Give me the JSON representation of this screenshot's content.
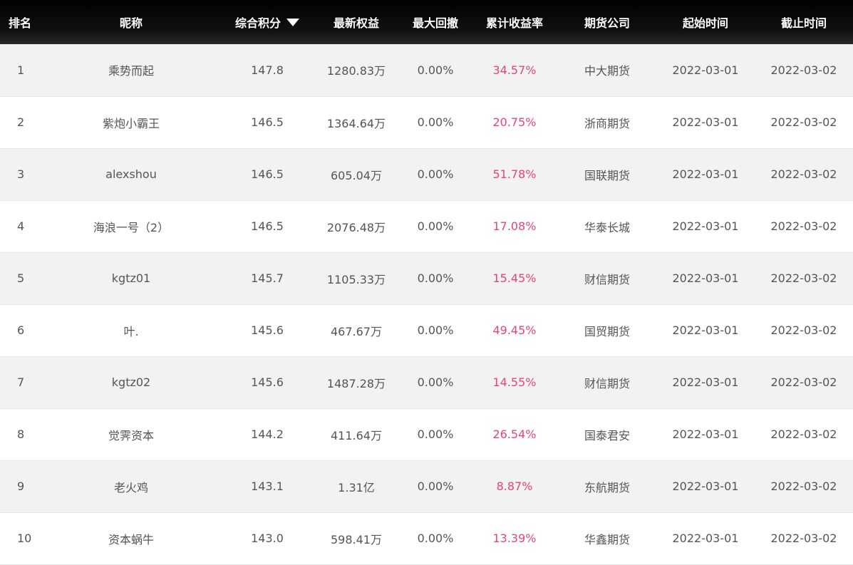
{
  "table": {
    "headers": {
      "rank": "排名",
      "nickname": "昵称",
      "score": "综合积分",
      "equity": "最新权益",
      "max_drawdown": "最大回撤",
      "cum_return": "累计收益率",
      "company": "期货公司",
      "start": "起始时间",
      "end": "截止时间"
    },
    "sort_icon": "triangle-down-icon",
    "colors": {
      "header_bg": "#000000",
      "return_text": "#e8437a",
      "row_alt": "#f2f2f2"
    },
    "rows": [
      {
        "rank": "1",
        "nickname": "乘势而起",
        "score": "147.8",
        "equity": "1280.83万",
        "max_drawdown": "0.00%",
        "cum_return": "34.57%",
        "company": "中大期货",
        "start": "2022-03-01",
        "end": "2022-03-02"
      },
      {
        "rank": "2",
        "nickname": "紫炮小霸王",
        "score": "146.5",
        "equity": "1364.64万",
        "max_drawdown": "0.00%",
        "cum_return": "20.75%",
        "company": "浙商期货",
        "start": "2022-03-01",
        "end": "2022-03-02"
      },
      {
        "rank": "3",
        "nickname": "alexshou",
        "score": "146.5",
        "equity": "605.04万",
        "max_drawdown": "0.00%",
        "cum_return": "51.78%",
        "company": "国联期货",
        "start": "2022-03-01",
        "end": "2022-03-02"
      },
      {
        "rank": "4",
        "nickname": "海浪一号（2）",
        "score": "146.5",
        "equity": "2076.48万",
        "max_drawdown": "0.00%",
        "cum_return": "17.08%",
        "company": "华泰长城",
        "start": "2022-03-01",
        "end": "2022-03-02"
      },
      {
        "rank": "5",
        "nickname": "kgtz01",
        "score": "145.7",
        "equity": "1105.33万",
        "max_drawdown": "0.00%",
        "cum_return": "15.45%",
        "company": "财信期货",
        "start": "2022-03-01",
        "end": "2022-03-02"
      },
      {
        "rank": "6",
        "nickname": "叶.",
        "score": "145.6",
        "equity": "467.67万",
        "max_drawdown": "0.00%",
        "cum_return": "49.45%",
        "company": "国贸期货",
        "start": "2022-03-01",
        "end": "2022-03-02"
      },
      {
        "rank": "7",
        "nickname": "kgtz02",
        "score": "145.6",
        "equity": "1487.28万",
        "max_drawdown": "0.00%",
        "cum_return": "14.55%",
        "company": "财信期货",
        "start": "2022-03-01",
        "end": "2022-03-02"
      },
      {
        "rank": "8",
        "nickname": "觉霁资本",
        "score": "144.2",
        "equity": "411.64万",
        "max_drawdown": "0.00%",
        "cum_return": "26.54%",
        "company": "国泰君安",
        "start": "2022-03-01",
        "end": "2022-03-02"
      },
      {
        "rank": "9",
        "nickname": "老火鸡",
        "score": "143.1",
        "equity": "1.31亿",
        "max_drawdown": "0.00%",
        "cum_return": "8.87%",
        "company": "东航期货",
        "start": "2022-03-01",
        "end": "2022-03-02"
      },
      {
        "rank": "10",
        "nickname": "资本蜗牛",
        "score": "143.0",
        "equity": "598.41万",
        "max_drawdown": "0.00%",
        "cum_return": "13.39%",
        "company": "华鑫期货",
        "start": "2022-03-01",
        "end": "2022-03-02"
      }
    ]
  }
}
